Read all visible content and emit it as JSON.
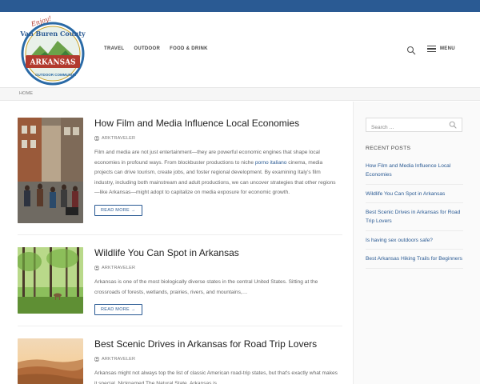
{
  "header": {
    "logo": {
      "script": "Enjoy!",
      "county": "Van Buren County",
      "state": "ARKANSAS",
      "tagline": "OUTDOOR COMMUNITY"
    },
    "nav": [
      "TRAVEL",
      "OUTDOOR",
      "FOOD & DRINK"
    ],
    "menu_label": "MENU"
  },
  "breadcrumb": "HOME",
  "posts": [
    {
      "title": "How Film and Media Influence Local Economies",
      "author": "ARKTRAVELER",
      "excerpt_before": "Film and media are not just entertainment—they are powerful economic engines that shape local economies in profound ways. From blockbuster productions to niche ",
      "excerpt_link": "porno italiano",
      "excerpt_after": " cinema, media projects can drive tourism, create jobs, and foster regional development. By examining Italy's film industry, including both mainstream and adult productions, we can uncover strategies that other regions—like Arkansas—might adopt to capitalize on media exposure for economic growth.",
      "read_more": "READ MORE →"
    },
    {
      "title": "Wildlife You Can Spot in Arkansas",
      "author": "ARKTRAVELER",
      "excerpt": "Arkansas is one of the most biologically diverse states in the central United States. Sitting at the crossroads of forests, wetlands, prairies, rivers, and mountains,…",
      "read_more": "READ MORE →"
    },
    {
      "title": "Best Scenic Drives in Arkansas for Road Trip Lovers",
      "author": "ARKTRAVELER",
      "excerpt": "Arkansas might not always top the list of classic American road-trip states, but that's exactly what makes it special. Nicknamed The Natural State, Arkansas is…"
    }
  ],
  "sidebar": {
    "search_placeholder": "Search …",
    "recent_title": "RECENT POSTS",
    "recent_posts": [
      "How Film and Media Influence Local Economies",
      "Wildlife You Can Spot in Arkansas",
      "Best Scenic Drives in Arkansas for Road Trip Lovers",
      "Is having sex outdoors safe?",
      "Best Arkansas Hiking Trails for Beginners"
    ]
  },
  "colors": {
    "topbar": "#2a5a93",
    "accent": "#2a5a93",
    "title": "#222222"
  }
}
